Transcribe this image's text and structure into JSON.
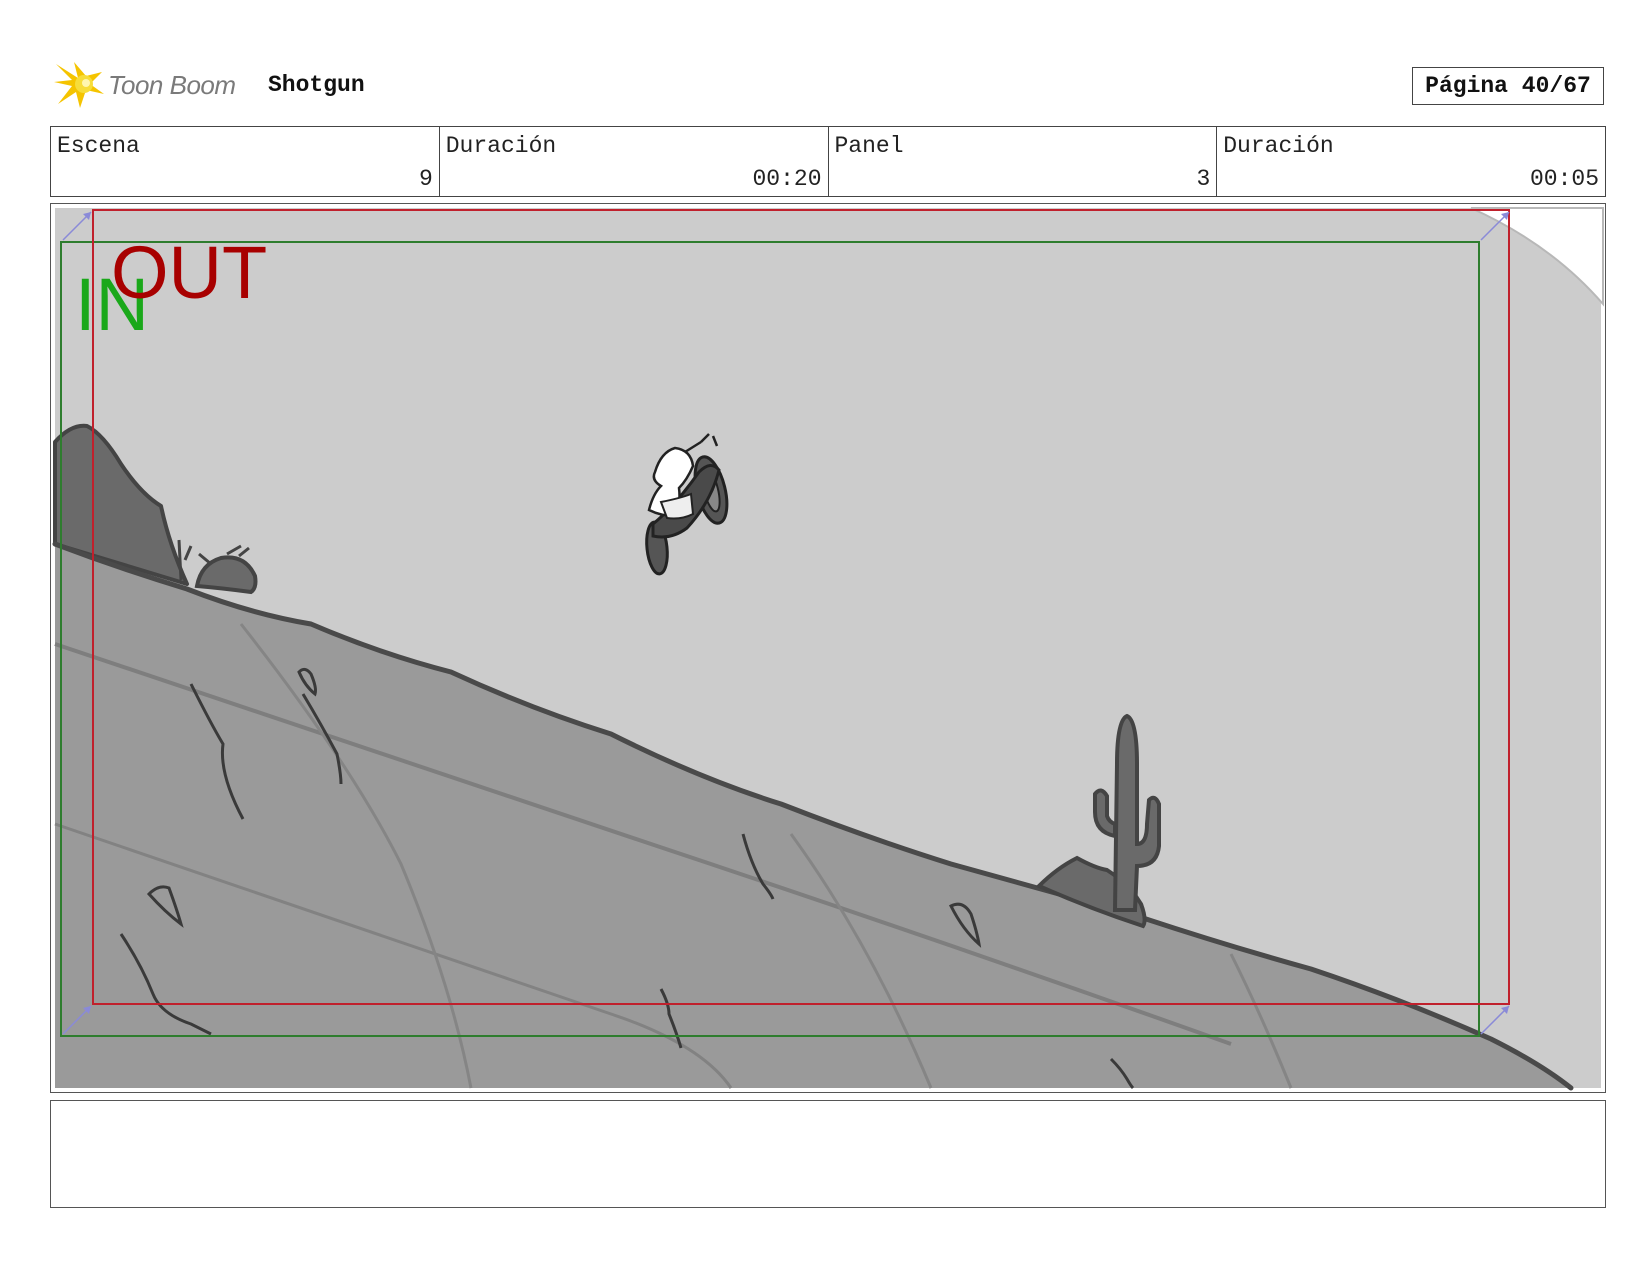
{
  "header": {
    "logo_text": "Toon Boom",
    "project_title": "Shotgun",
    "page_label": "Página 40/67"
  },
  "info": {
    "scene_label": "Escena",
    "scene_value": "9",
    "scene_duration_label": "Duración",
    "scene_duration_value": "00:20",
    "panel_label": "Panel",
    "panel_value": "3",
    "panel_duration_label": "Duración",
    "panel_duration_value": "00:05"
  },
  "panel": {
    "in_label": "IN",
    "out_label": "OUT",
    "in_color": "#1aa81a",
    "out_color": "#a80000",
    "in_frame_color": "#2e7d2e",
    "out_frame_color": "#c0202c",
    "sky_color": "#cccccc",
    "ground_color": "#9a9a9a",
    "rock_color": "#666666"
  },
  "notes": {
    "text": ""
  }
}
